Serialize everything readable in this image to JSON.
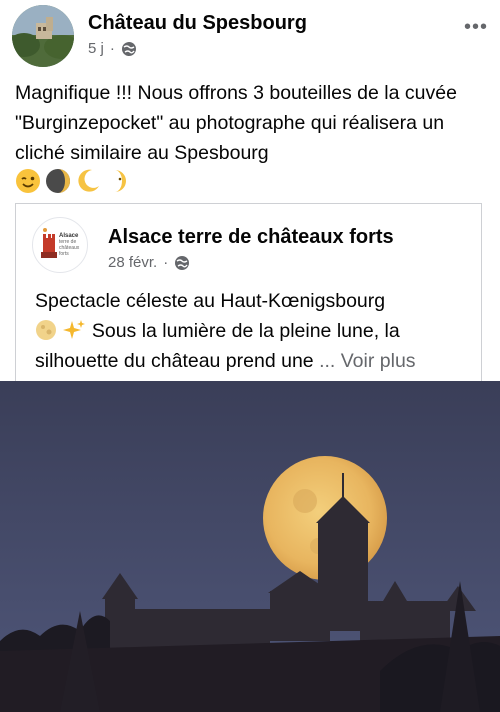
{
  "post": {
    "author": "Château du Spesbourg",
    "time": "5 j",
    "separator": "·",
    "more": "•••",
    "text": "Magnifique !!! Nous offrons 3 bouteilles de la cuvée \"Burginzepocket\" au photographe qui réalisera un cliché similaire au Spesbourg",
    "emojis": [
      "winking-face",
      "new-moon-face",
      "crescent-moon",
      "first-quarter-moon-face"
    ]
  },
  "shared": {
    "author": "Alsace terre de châteaux forts",
    "logo_text": {
      "line1": "Alsace",
      "line2": "terre de",
      "line3": "châteaux",
      "line4": "forts"
    },
    "time": "28 févr.",
    "separator": "·",
    "text_line1": "Spectacle céleste au Haut-Kœnigsbourg",
    "text_line2": "Sous la lumière de la pleine lune, la",
    "text_line3": "silhouette du château prend une",
    "ellipsis": "...",
    "see_more": "Voir plus",
    "emojis": [
      "full-moon",
      "sparkles"
    ]
  },
  "colors": {
    "text": "#050505",
    "muted": "#65676b",
    "border": "#ced0d4",
    "moon": "#e8b55f",
    "sky_top": "#3a3e58",
    "sky_bottom": "#50577a"
  }
}
